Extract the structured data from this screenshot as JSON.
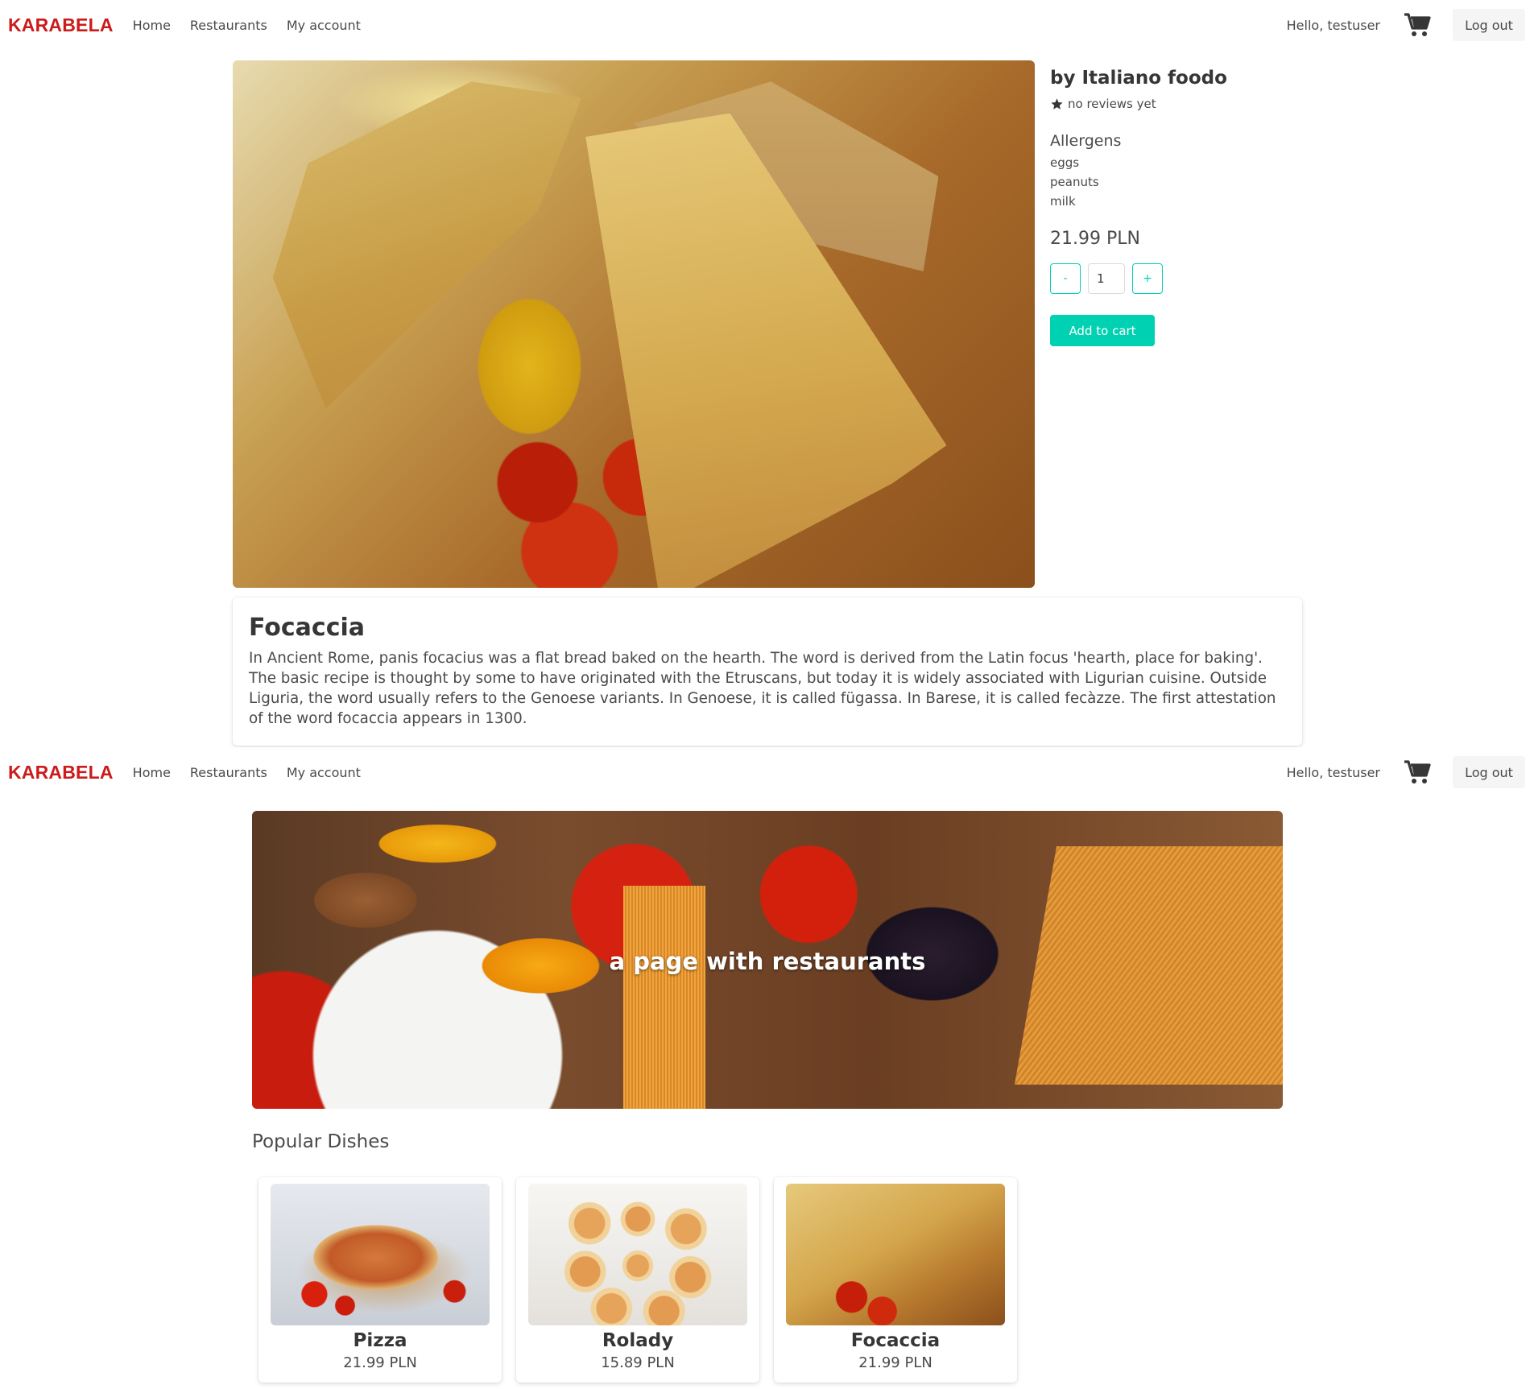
{
  "navbar": {
    "brand": "KARABELA",
    "links": [
      "Home",
      "Restaurants",
      "My account"
    ],
    "greeting": "Hello, testuser",
    "logout_label": "Log out",
    "cart_icon": "shopping-cart-icon"
  },
  "product": {
    "by_line": "by Italiano foodo",
    "reviews": "no reviews yet",
    "allergens_title": "Allergens",
    "allergens": [
      "eggs",
      "peanuts",
      "milk"
    ],
    "price": "21.99 PLN",
    "quantity": "1",
    "minus_label": "-",
    "plus_label": "+",
    "add_to_cart_label": "Add to cart",
    "name": "Focaccia",
    "description": "In Ancient Rome, panis focacius was a flat bread baked on the hearth. The word is derived from the Latin focus 'hearth, place for baking'. The basic recipe is thought by some to have originated with the Etruscans, but today it is widely associated with Ligurian cuisine. Outside Liguria, the word usually refers to the Genoese variants. In Genoese, it is called fügassa. In Barese, it is called fecàzze. The first attestation of the word focaccia appears in 1300."
  },
  "home": {
    "hero_text": "a page with restaurants",
    "popular_title": "Popular Dishes",
    "dishes": [
      {
        "name": "Pizza",
        "price": "21.99 PLN"
      },
      {
        "name": "Rolady",
        "price": "15.89 PLN"
      },
      {
        "name": "Focaccia",
        "price": "21.99 PLN"
      }
    ]
  },
  "colors": {
    "brand": "#cc1b1b",
    "accent": "#00d1b2"
  }
}
